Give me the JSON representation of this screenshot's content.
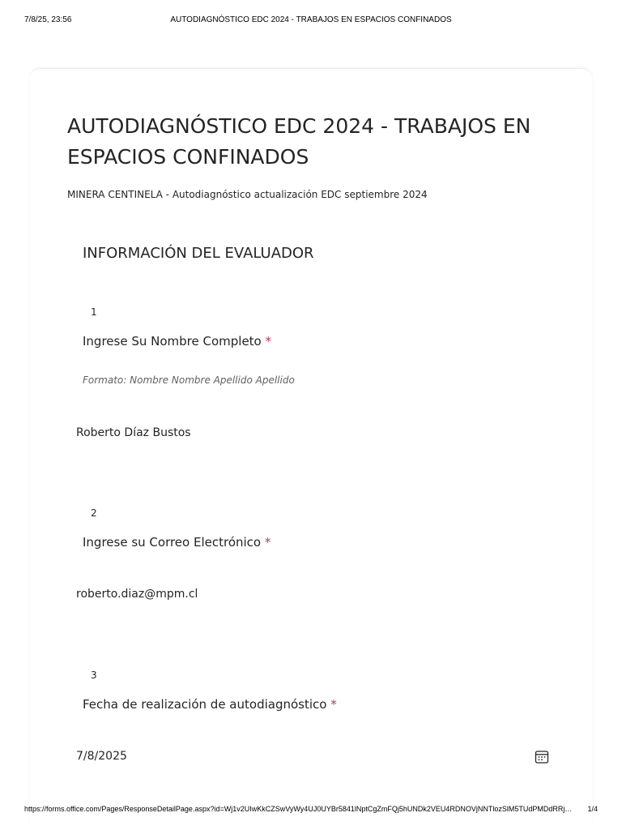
{
  "print": {
    "date": "7/8/25, 23:56",
    "title": "AUTODIAGNÓSTICO EDC 2024 - TRABAJOS EN ESPACIOS CONFINADOS",
    "url": "https://forms.office.com/Pages/ResponseDetailPage.aspx?id=Wj1v2UIwKkCZSwVyWy4UJ0UYBr5841lNptCgZmFQj5hUNDk2VEU4RDNOVjNNTlozSlM5TUdPMDdRRjVaTy4u",
    "page": "1/4"
  },
  "form": {
    "title": "AUTODIAGNÓSTICO EDC 2024 - TRABAJOS EN ESPACIOS CONFINADOS",
    "subtitle": "MINERA CENTINELA - Autodiagnóstico actualización EDC septiembre 2024",
    "section": "INFORMACIÓN DEL EVALUADOR"
  },
  "questions": [
    {
      "number": "1",
      "label": "Ingrese Su Nombre Completo",
      "required_mark": "*",
      "hint": "Formato: Nombre Nombre Apellido Apellido",
      "answer": "Roberto Díaz Bustos"
    },
    {
      "number": "2",
      "label": "Ingrese su Correo Electrónico",
      "required_mark": "*",
      "answer": "roberto.diaz@mpm.cl"
    },
    {
      "number": "3",
      "label": "Fecha de realización de autodiagnóstico",
      "required_mark": "*",
      "answer": "7/8/2025",
      "icon": "calendar-icon"
    }
  ],
  "colors": {
    "required": "#c4314b",
    "text": "#242424",
    "hint": "#616161"
  }
}
